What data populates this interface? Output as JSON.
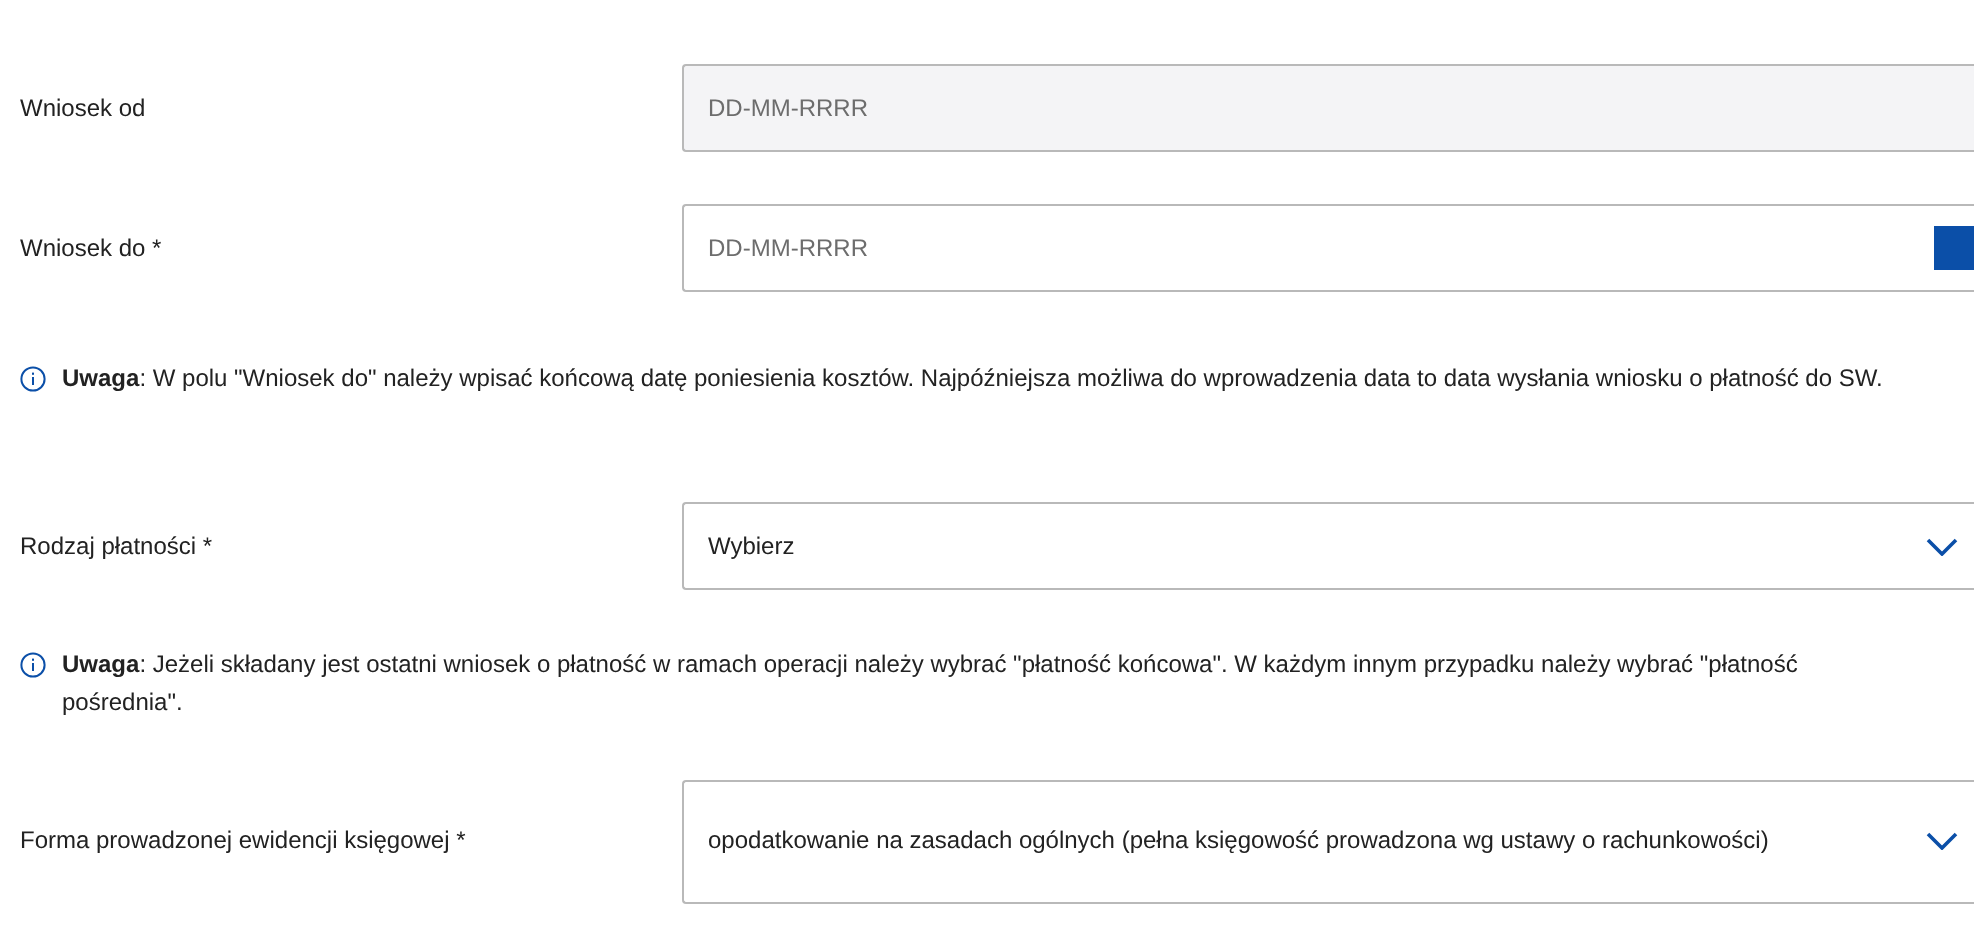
{
  "form": [
    {
      "kind": "date",
      "label": "Wniosek od",
      "placeholder": "DD-MM-RRRR",
      "disabled": true
    },
    {
      "kind": "date",
      "label": "Wniosek do *",
      "placeholder": "DD-MM-RRRR",
      "disabled": false
    },
    {
      "kind": "note",
      "text": "**Uwaga**: W polu \"Wniosek do\" należy wpisać końcową datę poniesienia kosztów. Najpóźniejsza możliwa do wprowadzenia data to data wysłania wniosku o płatność do SW."
    },
    {
      "kind": "select",
      "label": "Rodzaj płatności *",
      "value": "Wybierz"
    },
    {
      "kind": "note",
      "text": "**Uwaga**: Jeżeli składany jest ostatni wniosek o płatność w ramach operacji należy wybrać \"płatność końcowa\". W każdym innym przypadku należy wybrać \"płatność pośrednia\"."
    },
    {
      "kind": "select",
      "label": "Forma prowadzonej ewidencji księgowej *",
      "value": "opodatkowanie na zasadach ogólnych (pełna księgowość prowadzona wg ustawy o rachunkowości)"
    }
  ]
}
